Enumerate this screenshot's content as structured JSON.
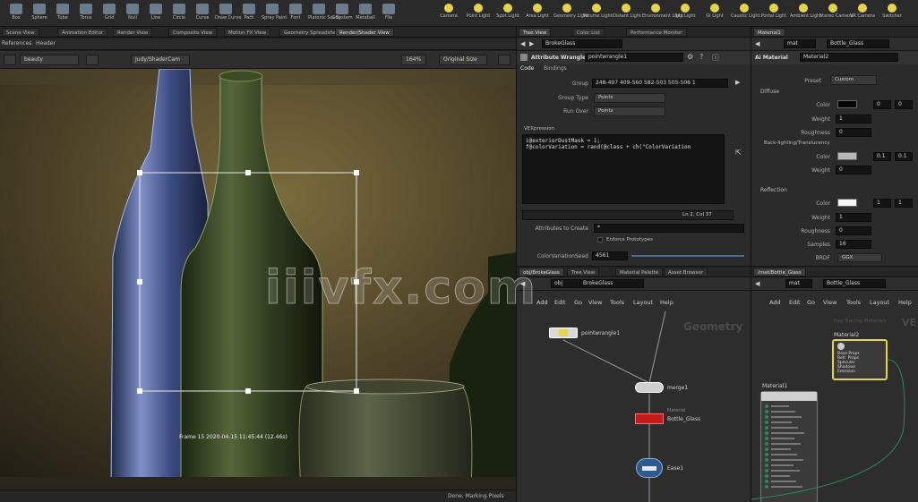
{
  "shelf": {
    "tools": [
      "Box",
      "Sphere",
      "Tube",
      "Torus",
      "Grid",
      "Null",
      "Line",
      "Circle",
      "Curve",
      "Draw Curve",
      "Path",
      "Spray Paint",
      "Font",
      "Platonic Solids",
      "L-System",
      "Metaball",
      "File"
    ],
    "lights": [
      "Camera",
      "Point Light",
      "Spot Light",
      "Area Light",
      "Geometry Light",
      "Volume Light",
      "Distant Light",
      "Environment Light",
      "Sky Light",
      "GI Light",
      "Caustic Light",
      "Portal Light",
      "Ambient Light",
      "Stereo Camera",
      "VR Camera",
      "Switcher"
    ]
  },
  "viewer": {
    "tabs": [
      "References",
      "Header"
    ],
    "tabs_top": [
      "Scene View",
      "Animation Editor",
      "Render View",
      "Composite View",
      "Motion FX View",
      "Geometry Spreadsheet",
      "Render/Shader View"
    ],
    "aov": "beauty",
    "camera": "Judy/ShaderCam",
    "zoom": "164%",
    "size_mode": "Original Size",
    "info": "Frame 15  2020-04-15  11:45:44  (12.46s)",
    "status": "Done. Marking Pixels"
  },
  "params": {
    "tabs_top": [
      "Tree View",
      "Color List",
      "Performance Monitor"
    ],
    "path": "BrokeGlass",
    "node_type": "Attribute Wrangle",
    "node_name": "pointwrangle1",
    "subtabs": [
      "Code",
      "Bindings"
    ],
    "group_label": "Group",
    "group_value": "248-497 409-560 582-503 505-506 1",
    "group_type_label": "Group Type",
    "group_type_value": "Points",
    "run_over_label": "Run Over",
    "run_over_value": "Points",
    "vex_label": "VEXpression",
    "code_line1": "i@exteriorDustMask = 1;",
    "code_line2": "f@colorVariation = rand(@class + ch(\"ColorVariation",
    "cursor_pos": "Ln 2, Col 37",
    "attrs_label": "Attributes to Create",
    "attrs_value": "*",
    "enforce_label": "Enforce Prototypes",
    "colorvar_label": "ColorVariationSeed",
    "colorvar_value": "4561"
  },
  "material": {
    "tabs_top": [
      "Material1"
    ],
    "path_mat": "mat",
    "path_node": "Bottle_Glass",
    "node_type": "Ai Material",
    "node_name": "Material2",
    "preset_label": "Preset",
    "preset_value": "Custom",
    "diffuse_section": "Diffuse",
    "color_label": "Color",
    "color_r": "0",
    "color_g": "0",
    "weight_label": "Weight",
    "weight_value": "1",
    "roughness_label": "Roughness",
    "roughness_value": "0",
    "backlight_section": "Back-lighting/Translucency",
    "bl_color_label": "Color",
    "bl_color_r": "0.1",
    "bl_color_g": "0.1",
    "bl_weight_label": "Weight",
    "bl_weight_value": "0",
    "reflection_section": "Reflection",
    "rf_color_label": "Color",
    "rf_color_r": "1",
    "rf_color_g": "1",
    "rf_weight_label": "Weight",
    "rf_weight_value": "1",
    "rf_rough_label": "Roughness",
    "rf_rough_value": "0",
    "samples_label": "Samples",
    "samples_value": "16",
    "brdf_label": "BRDF",
    "brdf_value": "GGX"
  },
  "network": {
    "tabs_top": [
      "obj/BrokeGlass",
      "Tree View",
      "Material Palette",
      "Asset Browser"
    ],
    "path_obj": "obj",
    "path_node": "BrokeGlass",
    "menus": [
      "Add",
      "Edit",
      "Go",
      "View",
      "Tools",
      "Layout",
      "Help"
    ],
    "context_label": "Geometry",
    "nodes": [
      "pointwrangle1",
      "merge1",
      "Bottle_Glass",
      "Ease1"
    ],
    "bottle_sub": "Material"
  },
  "matnet": {
    "tabs_top": [
      "/mat/Bottle_Glass"
    ],
    "path_mat": "mat",
    "path_node": "Bottle_Glass",
    "menus": [
      "Add",
      "Edit",
      "Go",
      "View",
      "Tools",
      "Layout",
      "Help"
    ],
    "context_label": "Ray Tracing Materials",
    "context_short": "VE",
    "material1": "Material1",
    "material2": "Material2",
    "m2_rows": [
      "Base Props",
      "Refr. Props",
      "Specular",
      "Shadows",
      "Emission"
    ]
  },
  "watermark": "iiivfx.com",
  "colors": {
    "accent_yellow": "#e5d44a",
    "node_red": "#c31a1a",
    "node_blue": "#2e5a8f",
    "panel": "#2b2b2b"
  }
}
